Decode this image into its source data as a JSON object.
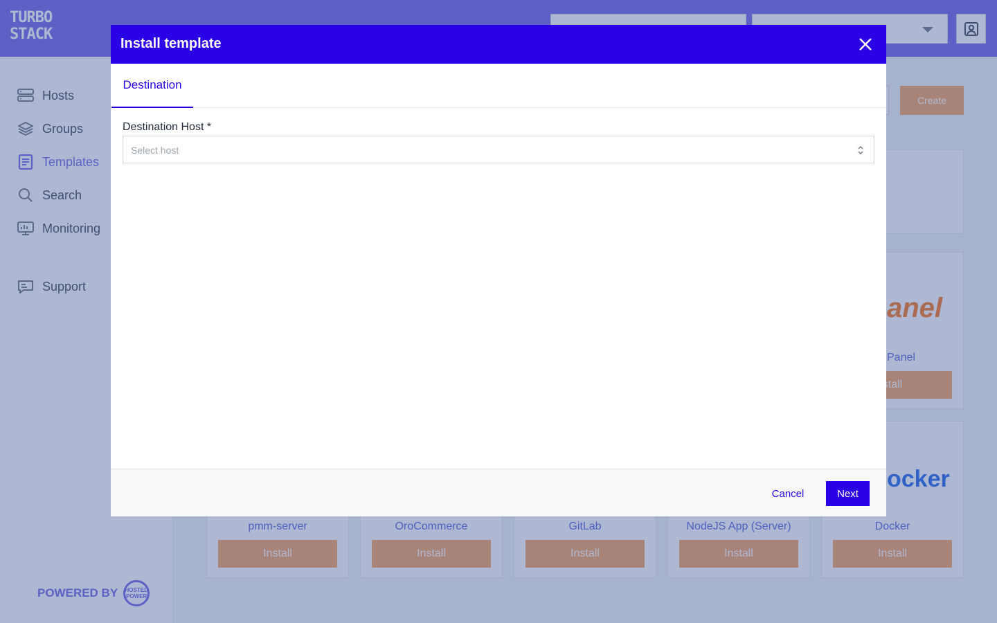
{
  "brand": {
    "logo_line1": "TURBO",
    "logo_line2": "STACK"
  },
  "sidebar": {
    "items": [
      {
        "label": "Hosts",
        "icon": "server-icon"
      },
      {
        "label": "Groups",
        "icon": "layers-icon"
      },
      {
        "label": "Templates",
        "icon": "document-icon"
      },
      {
        "label": "Search",
        "icon": "search-icon"
      },
      {
        "label": "Monitoring",
        "icon": "monitor-icon"
      },
      {
        "label": "Support",
        "icon": "support-chat-icon"
      }
    ],
    "active": "Templates",
    "powered_by": "POWERED BY",
    "powered_logo_text": "HOSTED POWER"
  },
  "main": {
    "create_label": "Create",
    "cards": [
      {
        "name": "pmm-server",
        "install": "Install"
      },
      {
        "name": "OroCommerce",
        "install": "Install"
      },
      {
        "name": "GitLab",
        "install": "Install"
      },
      {
        "name": "NodeJS App (Server)",
        "install": "Install"
      },
      {
        "name": "Docker",
        "install": "Install",
        "logo": "ocker"
      },
      {
        "name": "Panel",
        "install": "stall",
        "logo": "anel"
      }
    ]
  },
  "modal": {
    "title": "Install template",
    "tab": "Destination",
    "field_label": "Destination Host *",
    "select_placeholder": "Select host",
    "cancel": "Cancel",
    "next": "Next"
  },
  "colors": {
    "header_blue": "#2a00e6",
    "brand_purple": "#6c5fe6",
    "install_orange": "#f59e5b"
  }
}
